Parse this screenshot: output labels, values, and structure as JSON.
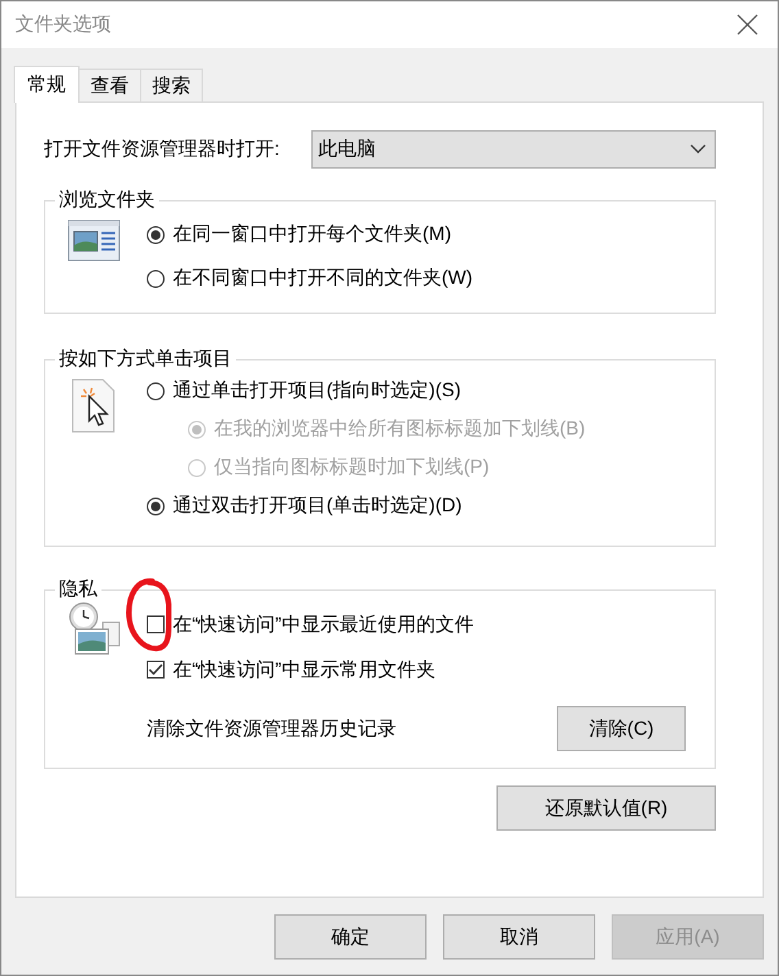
{
  "window": {
    "title": "文件夹选项"
  },
  "tabs": [
    {
      "label": "常规",
      "selected": true
    },
    {
      "label": "查看",
      "selected": false
    },
    {
      "label": "搜索",
      "selected": false
    }
  ],
  "open_in": {
    "label": "打开文件资源管理器时打开:",
    "value": "此电脑"
  },
  "browse_folders": {
    "title": "浏览文件夹",
    "options": [
      {
        "label": "在同一窗口中打开每个文件夹(M)",
        "selected": true,
        "disabled": false
      },
      {
        "label": "在不同窗口中打开不同的文件夹(W)",
        "selected": false,
        "disabled": false
      }
    ]
  },
  "click_items": {
    "title": "按如下方式单击项目",
    "options": [
      {
        "label": "通过单击打开项目(指向时选定)(S)",
        "selected": false,
        "disabled": false,
        "children": [
          {
            "label": "在我的浏览器中给所有图标标题加下划线(B)",
            "selected": true,
            "disabled": true
          },
          {
            "label": "仅当指向图标标题时加下划线(P)",
            "selected": false,
            "disabled": true
          }
        ]
      },
      {
        "label": "通过双击打开项目(单击时选定)(D)",
        "selected": true,
        "disabled": false
      }
    ]
  },
  "privacy": {
    "title": "隐私",
    "checkboxes": [
      {
        "label": "在“快速访问”中显示最近使用的文件",
        "checked": false
      },
      {
        "label": "在“快速访问”中显示常用文件夹",
        "checked": true
      }
    ],
    "clear_label": "清除文件资源管理器历史记录",
    "clear_button": "清除(C)"
  },
  "restore_button": "还原默认值(R)",
  "buttons": [
    {
      "label": "确定",
      "disabled": false
    },
    {
      "label": "取消",
      "disabled": false
    },
    {
      "label": "应用(A)",
      "disabled": true
    }
  ]
}
